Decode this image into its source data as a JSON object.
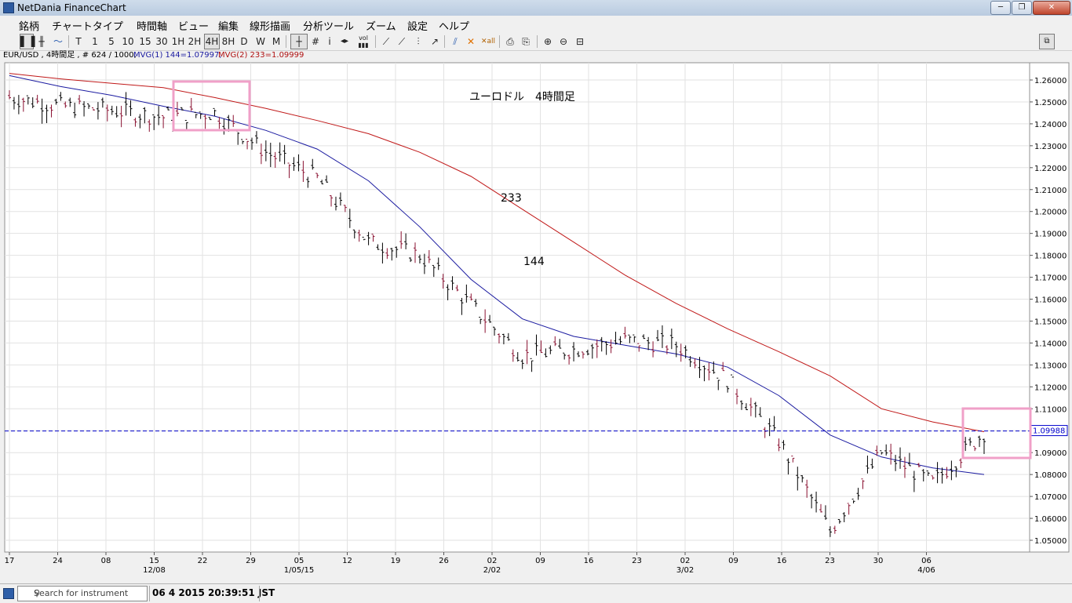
{
  "window": {
    "title": "NetDania FinanceChart",
    "minimize": "─",
    "maximize": "❐",
    "close": "✕"
  },
  "menu": [
    "銘柄",
    "チャートタイプ",
    "時間軸",
    "ビュー",
    "編集",
    "線形描画",
    "分析ツール",
    "ズーム",
    "設定",
    "ヘルプ"
  ],
  "toolbar": {
    "timeframes": [
      "T",
      "1",
      "5",
      "10",
      "15",
      "30",
      "1H",
      "2H",
      "4H",
      "8H",
      "D",
      "W",
      "M"
    ],
    "selected": "4H",
    "tool_icons": [
      "bar-chart-icon",
      "candle-chart-icon",
      "line-chart-icon",
      "crosshair-icon",
      "grid-icon",
      "info-icon",
      "arrows-icon",
      "volume-icon",
      "trendline-icon",
      "channel-icon",
      "fib-icon",
      "ray-icon",
      "delete-icon",
      "delete-all-icon",
      "print-icon",
      "print-preview-icon",
      "zoom-in-icon",
      "zoom-out-icon",
      "zoom-fit-icon"
    ]
  },
  "info": {
    "symbol": "EUR/USD , 4時間足 , # 624 / 1000,",
    "mvg1": "MVG(1) 144=1.07997,",
    "mvg2": "MVG(2) 233=1.09999"
  },
  "colors": {
    "ma144": "#1a1aa0",
    "ma233": "#c01818",
    "price_line": "#0000cc",
    "highlight_box": "#f0a0c8",
    "bar": "#000000",
    "accent_bar": "#8a1030"
  },
  "chart_data": {
    "type": "line",
    "title": "ユーロドル　4時間足",
    "annotations": [
      {
        "text": "233"
      },
      {
        "text": "144"
      }
    ],
    "ylim": [
      1.045,
      1.265
    ],
    "y_ticks": [
      "1.26000",
      "1.25000",
      "1.24000",
      "1.23000",
      "1.22000",
      "1.21000",
      "1.20000",
      "1.19000",
      "1.18000",
      "1.17000",
      "1.16000",
      "1.15000",
      "1.14000",
      "1.13000",
      "1.12000",
      "1.11000",
      "1.10000",
      "1.09000",
      "1.08000",
      "1.07000",
      "1.06000",
      "1.05000"
    ],
    "current_price": "1.09988",
    "x_ticks": [
      "17",
      "24",
      "08",
      "15",
      "22",
      "29",
      "05",
      "12",
      "19",
      "26",
      "02",
      "09",
      "16",
      "23",
      "02",
      "09",
      "16",
      "23",
      "30",
      "06"
    ],
    "x_month_labels": [
      "12/08",
      "1/05/15",
      "2/02",
      "3/02",
      "4/06"
    ],
    "series": [
      {
        "name": "233",
        "values": [
          1.263,
          1.2605,
          1.2585,
          1.2565,
          1.252,
          1.247,
          1.2415,
          1.2355,
          1.227,
          1.216,
          1.201,
          1.186,
          1.171,
          1.158,
          1.1465,
          1.136,
          1.125,
          1.11,
          1.104,
          1.0995
        ]
      },
      {
        "name": "144",
        "values": [
          1.262,
          1.257,
          1.253,
          1.248,
          1.2435,
          1.237,
          1.2285,
          1.214,
          1.193,
          1.169,
          1.151,
          1.143,
          1.139,
          1.135,
          1.129,
          1.116,
          1.098,
          1.088,
          1.083,
          1.08
        ]
      },
      {
        "name": "EUR/USD",
        "values": [
          1.252,
          1.248,
          1.246,
          1.243,
          1.245,
          1.227,
          1.215,
          1.186,
          1.18,
          1.157,
          1.134,
          1.137,
          1.141,
          1.139,
          1.123,
          1.095,
          1.054,
          1.09,
          1.076,
          1.099
        ]
      }
    ]
  },
  "status": {
    "search_placeholder": "Search for instrument",
    "datetime": "06 4 2015 20:39:51 JST"
  }
}
